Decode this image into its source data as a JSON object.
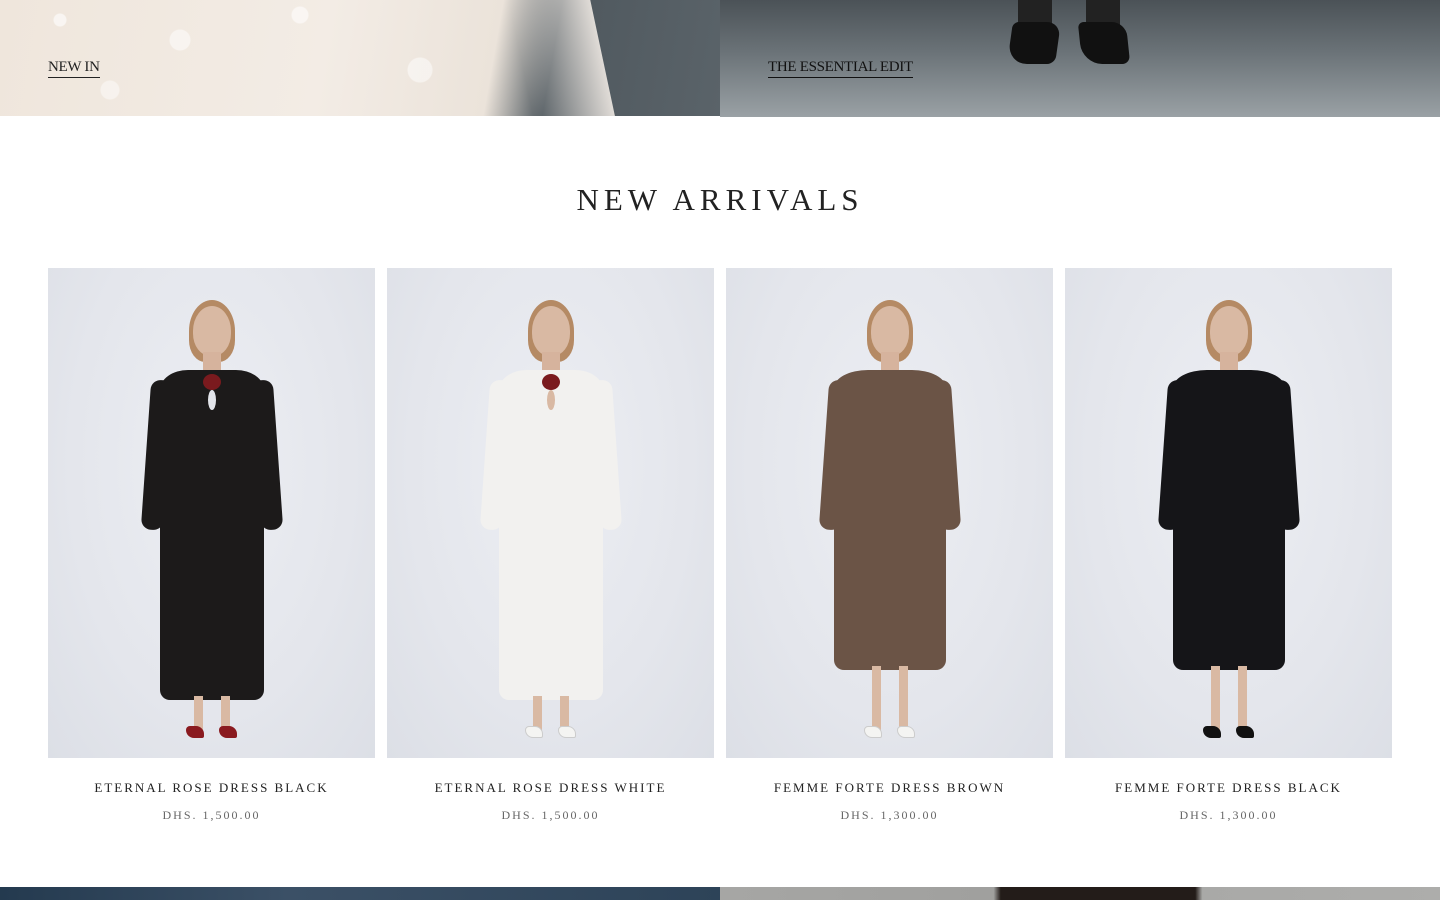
{
  "hero": {
    "left_link": "NEW IN",
    "right_link": "THE ESSENTIAL EDIT"
  },
  "new_arrivals": {
    "title": "NEW ARRIVALS",
    "products": [
      {
        "name": "ETERNAL ROSE DRESS BLACK",
        "price": "DHS. 1,500.00",
        "image_icon": "model-black-lace-dress-image"
      },
      {
        "name": "ETERNAL ROSE DRESS WHITE",
        "price": "DHS. 1,500.00",
        "image_icon": "model-white-lace-dress-image"
      },
      {
        "name": "FEMME FORTE DRESS BROWN",
        "price": "DHS. 1,300.00",
        "image_icon": "model-brown-dress-image"
      },
      {
        "name": "FEMME FORTE DRESS BLACK",
        "price": "DHS. 1,300.00",
        "image_icon": "model-black-dress-image"
      }
    ]
  },
  "colors": {
    "text": "#222222",
    "price": "#666666",
    "background": "#ffffff",
    "photo_bg": "#e4e6ec"
  }
}
